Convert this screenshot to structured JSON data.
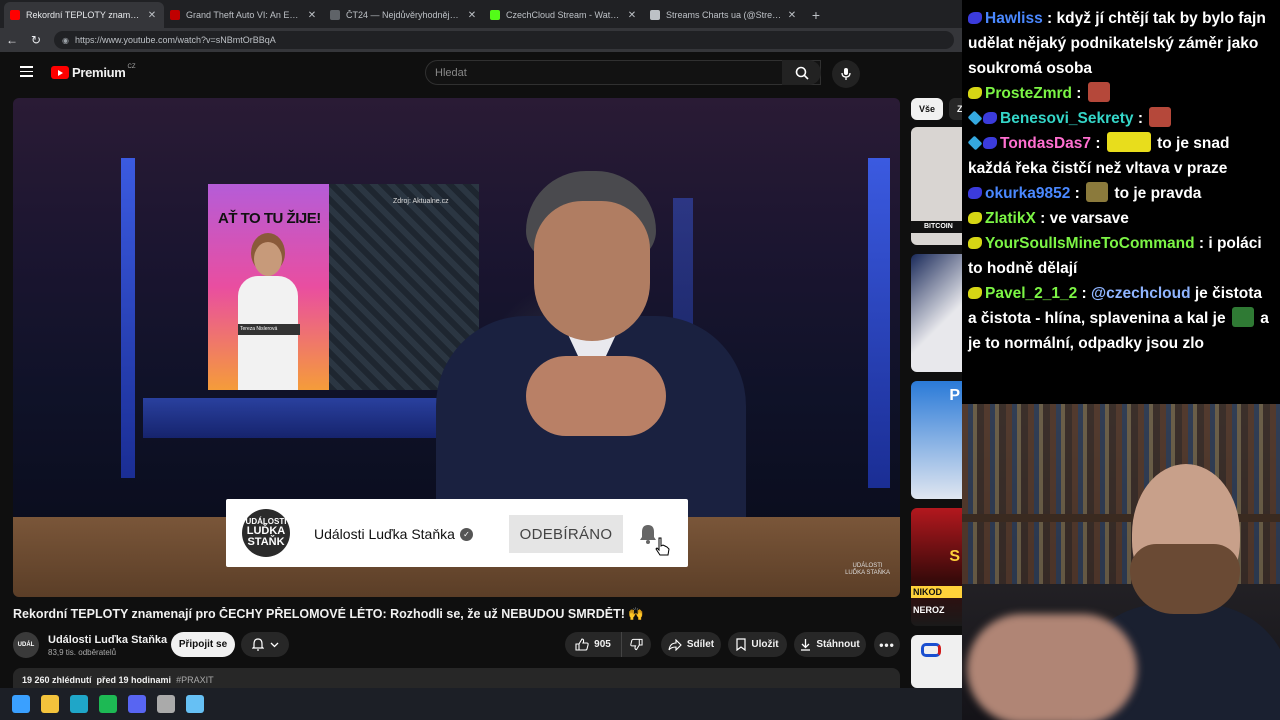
{
  "browser": {
    "tabs": [
      {
        "title": "Rekordní TEPLOTY znamenají pro Č",
        "favicon_color": "#ff0000",
        "active": true
      },
      {
        "title": "Grand Theft Auto VI: An Extended",
        "favicon_color": "#c00000",
        "active": false
      },
      {
        "title": "ČT24 — Nejdůvěryhodnější zprav",
        "favicon_color": "#5f6368",
        "active": false
      },
      {
        "title": "CzechCloud Stream - Watch Live o",
        "favicon_color": "#53fc18",
        "active": false
      },
      {
        "title": "Streams Charts ua (@StreamsCha",
        "favicon_color": "#bdc1c6",
        "active": false
      }
    ],
    "url": "https://www.youtube.com/watch?v=sNBmtOrBBqA"
  },
  "youtube": {
    "logo_text": "Premium",
    "country_code": "CZ",
    "search_placeholder": "Hledat",
    "chips": [
      "Vše",
      "Z"
    ],
    "video": {
      "poster_title": "AŤ TO TU ŽIJE!",
      "poster_name": "Tereza Nislerová",
      "source_label": "Zdroj: Aktualne.cz",
      "watermark": "UDÁLOSTI",
      "watermark_sub": "LUĎKA STAŇKA"
    },
    "subscribe_card": {
      "logo_line1": "UDÁLOSTI",
      "logo_line2": "LUĎKA",
      "logo_line3": "STAŇK",
      "channel_name": "Události Luďka Staňka",
      "button_label": "ODEBÍRÁNO"
    },
    "title": "Rekordní TEPLOTY znamenají pro ČECHY PŘELOMOVÉ LÉTO: Rozhodli se, že už NEBUDOU SMRDĚT! 🙌",
    "channel": {
      "name": "Události Luďka Staňka",
      "subscribers": "83,9 tis. odběratelů"
    },
    "join_label": "Připojit se",
    "likes": "905",
    "share_label": "Sdílet",
    "save_label": "Uložit",
    "download_label": "Stáhnout",
    "description": {
      "views": "19 260 zhlédnutí",
      "age": "před 19 hodinami",
      "hashtag": "#PRAXIT"
    },
    "thumbnails": [
      {
        "label": "BITCOIN",
        "color": "#d9d5d2"
      },
      {
        "label": "",
        "color": "#e8e8ec"
      },
      {
        "label": "P",
        "color": "#2a7ad8"
      },
      {
        "label": "S",
        "color": "#b3181e"
      },
      {
        "label": "NIKOD",
        "color": "#1a1a1a"
      },
      {
        "label": "NEROZ",
        "color": "#1a1a1a"
      },
      {
        "label": "",
        "color": "#f0f0f0"
      }
    ]
  },
  "chat": [
    {
      "badges": [
        "b"
      ],
      "user": "Hawliss",
      "color": "#4a88ff",
      "parts": [
        {
          "t": "text",
          "v": "když jí chtějí tak by bylo fajn udělat nějaký podnikatelský záměr jako soukromá osoba"
        }
      ]
    },
    {
      "badges": [
        "y"
      ],
      "user": "ProsteZmrd",
      "color": "#7cf545",
      "parts": [
        {
          "t": "emote",
          "color": "#b5483a"
        }
      ]
    },
    {
      "badges": [
        "c",
        "b"
      ],
      "user": "Benesovi_Sekrety",
      "color": "#34d6c8",
      "parts": [
        {
          "t": "emote",
          "color": "#b5483a"
        }
      ]
    },
    {
      "badges": [
        "c",
        "b"
      ],
      "user": "TondasDas7",
      "color": "#ff6fd0",
      "parts": [
        {
          "t": "emote",
          "color": "#e8dd1c",
          "wide": true
        },
        {
          "t": "text",
          "v": "to je snad každá řeka čistčí než vltava v praze"
        }
      ]
    },
    {
      "badges": [
        "b"
      ],
      "user": "okurka9852",
      "color": "#4a88ff",
      "parts": [
        {
          "t": "emote",
          "color": "#8b7a3c"
        },
        {
          "t": "text",
          "v": "to je pravda"
        }
      ]
    },
    {
      "badges": [
        "y"
      ],
      "user": "ZlatikX",
      "color": "#7cf545",
      "parts": [
        {
          "t": "text",
          "v": "ve varsave"
        }
      ]
    },
    {
      "badges": [
        "y"
      ],
      "user": "YourSoulIsMineToCommand",
      "color": "#7cf545",
      "parts": [
        {
          "t": "text",
          "v": "i poláci to hodně dělají"
        }
      ]
    },
    {
      "badges": [
        "y"
      ],
      "user": "Pavel_2_1_2",
      "color": "#7cf545",
      "parts": [
        {
          "t": "mention",
          "v": "@czechcloud"
        },
        {
          "t": "text",
          "v": "je čistota a čistota - hlína, splavenina a kal je"
        },
        {
          "t": "emote",
          "color": "#2f7a34"
        },
        {
          "t": "text",
          "v": "a je to normální, odpadky jsou zlo"
        }
      ]
    }
  ],
  "taskbar": [
    {
      "name": "windows-start-icon",
      "color": "#3aa0ff"
    },
    {
      "name": "file-explorer-icon",
      "color": "#f3c33c"
    },
    {
      "name": "edge-icon",
      "color": "#1fa6c8"
    },
    {
      "name": "spotify-icon",
      "color": "#1db954"
    },
    {
      "name": "discord-icon",
      "color": "#5865f2"
    },
    {
      "name": "obs-icon",
      "color": "#aaaaaa"
    },
    {
      "name": "steam-icon",
      "color": "#66c0f4"
    }
  ]
}
